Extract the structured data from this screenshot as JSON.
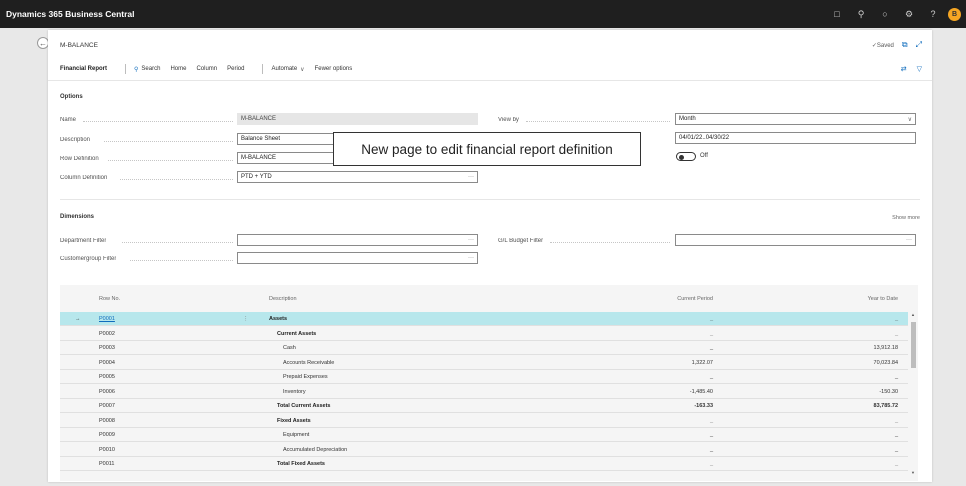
{
  "app": {
    "title": "Dynamics 365 Business Central",
    "avatar_initial": "B",
    "icons": [
      "document-icon",
      "search-icon",
      "bell-icon",
      "gear-icon",
      "help-icon"
    ]
  },
  "page": {
    "title": "M-BALANCE",
    "saved_status": "✓Saved"
  },
  "action_bar": {
    "primary": "Financial Report",
    "search": "Search",
    "home": "Home",
    "column": "Column",
    "period": "Period",
    "automate": "Automate",
    "fewer_options": "Fewer options"
  },
  "options": {
    "section_title": "Options",
    "name_label": "Name",
    "name_value": "M-BALANCE",
    "description_label": "Description",
    "description_value": "Balance Sheet",
    "row_definition_label": "Row Definition",
    "row_definition_value": "M-BALANCE",
    "column_definition_label": "Column Definition",
    "column_definition_value": "PTD + YTD",
    "view_by_label": "View by",
    "view_by_value": "Month",
    "date_filter_value": "04/01/22..04/30/22",
    "toggle_label": "Off"
  },
  "dimensions": {
    "section_title": "Dimensions",
    "show_more": "Show more",
    "department_filter_label": "Department Filter",
    "customergroup_filter_label": "Customergroup Filter",
    "gl_budget_filter_label": "G/L Budget Filter"
  },
  "callout": "New page to edit financial report definition",
  "grid": {
    "headers": {
      "row_no": "Row No.",
      "description": "Description",
      "current_period": "Current Period",
      "year_to_date": "Year to Date"
    },
    "rows": [
      {
        "row_no": "P0001",
        "description": "Assets",
        "indent": 0,
        "bold": true,
        "current": "_",
        "ytd": "_",
        "selected": true
      },
      {
        "row_no": "P0002",
        "description": "Current Assets",
        "indent": 1,
        "bold": true,
        "current": "_",
        "ytd": "_"
      },
      {
        "row_no": "P0003",
        "description": "Cash",
        "indent": 2,
        "bold": false,
        "current": "_",
        "ytd": "13,912.18"
      },
      {
        "row_no": "P0004",
        "description": "Accounts Receivable",
        "indent": 2,
        "bold": false,
        "current": "1,322.07",
        "ytd": "70,023.84"
      },
      {
        "row_no": "P0005",
        "description": "Prepaid Expenses",
        "indent": 2,
        "bold": false,
        "current": "_",
        "ytd": "_"
      },
      {
        "row_no": "P0006",
        "description": "Inventory",
        "indent": 2,
        "bold": false,
        "current": "-1,485.40",
        "ytd": "-150.30"
      },
      {
        "row_no": "P0007",
        "description": "Total Current Assets",
        "indent": 1,
        "bold": true,
        "current": "-163.33",
        "ytd": "83,785.72"
      },
      {
        "row_no": "P0008",
        "description": "Fixed Assets",
        "indent": 1,
        "bold": true,
        "current": "_",
        "ytd": "_"
      },
      {
        "row_no": "P0009",
        "description": "Equipment",
        "indent": 2,
        "bold": false,
        "current": "_",
        "ytd": "_"
      },
      {
        "row_no": "P0010",
        "description": "Accumulated Depreciation",
        "indent": 2,
        "bold": false,
        "current": "_",
        "ytd": "_"
      },
      {
        "row_no": "P0011",
        "description": "Total Fixed Assets",
        "indent": 1,
        "bold": true,
        "current": "_",
        "ytd": "_"
      }
    ]
  }
}
